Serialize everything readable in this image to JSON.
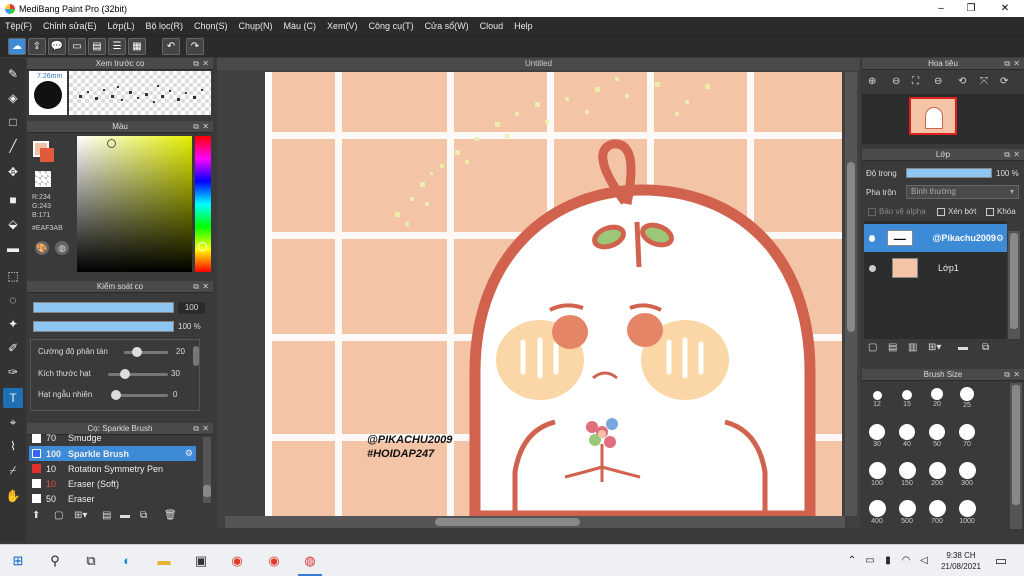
{
  "window": {
    "title": "MediBang Paint Pro (32bit)",
    "controls": [
      "–",
      "❐",
      "✕"
    ]
  },
  "menu": [
    "Tệp(F)",
    "Chỉnh sửa(E)",
    "Lớp(L)",
    "Bộ lọc(R)",
    "Chọn(S)",
    "Chụp(N)",
    "Màu (C)",
    "Xem(V)",
    "Công cụ(T)",
    "Cửa sổ(W)",
    "Cloud",
    "Help"
  ],
  "brush_preview": {
    "title": "Xem trước cọ",
    "size": "7.26mm"
  },
  "color": {
    "title": "Màu",
    "r": "R:234",
    "g": "G:243",
    "b": "B:171",
    "hex": "#EAF3AB",
    "primary": "#f0c2a2",
    "secondary": "#e05a3c"
  },
  "brush_control": {
    "title": "Kiểm soát cọ",
    "size_value": "100",
    "opacity_value": "100 %",
    "params": [
      {
        "label": "Cường độ phân tán",
        "value": "20"
      },
      {
        "label": "Kích thước hạt",
        "value": "30"
      },
      {
        "label": "Hạt ngẫu nhiên",
        "value": "0"
      }
    ]
  },
  "brush_list": {
    "title": "Cọ: Sparkle Brush",
    "items": [
      {
        "size": "70",
        "name": "Smudge",
        "color": "#ffffff"
      },
      {
        "size": "100",
        "name": "Sparkle Brush",
        "color": "#3366ff"
      },
      {
        "size": "10",
        "name": "Rotation Symmetry Pen",
        "color": "#e03030"
      },
      {
        "size": "10",
        "name": "Eraser (Soft)",
        "color": "#ffffff"
      },
      {
        "size": "50",
        "name": "Eraser",
        "color": "#ffffff"
      }
    ]
  },
  "document": {
    "tab": "Untitled",
    "watermark_1": "@PIKACHU2009",
    "watermark_2": "#HOIDAP247"
  },
  "navigator": {
    "title": "Hoa tiêu"
  },
  "layers": {
    "title": "Lớp",
    "opacity_label": "Độ trong",
    "opacity_value": "100 %",
    "blend_label": "Pha trộn",
    "blend_value": "Bình thường",
    "protect_alpha": "Bảo vệ alpha",
    "clipping": "Xén bớt",
    "lock": "Khóa",
    "items": [
      {
        "name": "@Pikachu2009",
        "selected": true
      },
      {
        "name": "Lớp1",
        "selected": false
      }
    ]
  },
  "brush_size": {
    "title": "Brush Size",
    "sizes": [
      "12",
      "15",
      "20",
      "25",
      "30",
      "40",
      "50",
      "70",
      "100",
      "150",
      "200",
      "300",
      "400",
      "500",
      "700",
      "1000"
    ]
  },
  "taskbar": {
    "time": "9:38 CH",
    "date": "21/08/2021"
  }
}
